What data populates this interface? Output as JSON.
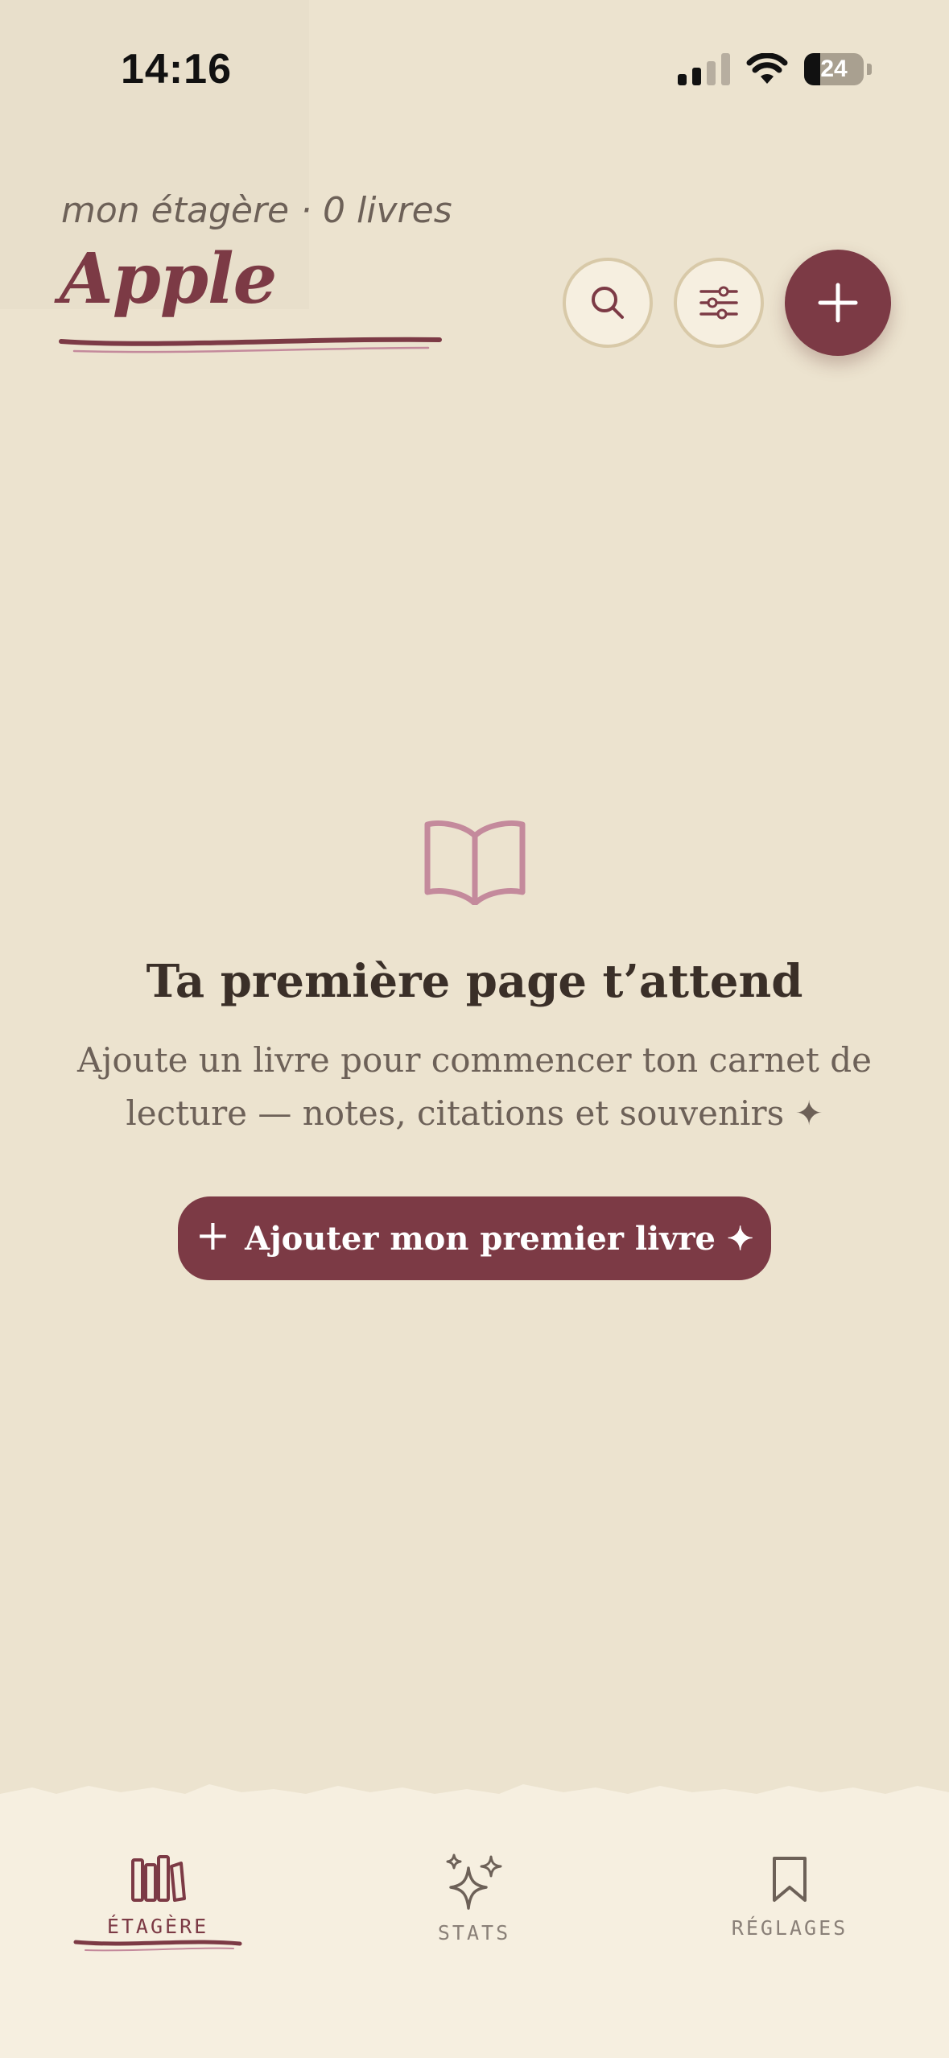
{
  "status_bar": {
    "time": "14:16",
    "battery": "24"
  },
  "header": {
    "subtitle": "mon étagère · 0 livres",
    "title": "Apple"
  },
  "actions": {
    "search_icon": "search-icon",
    "filter_icon": "sliders-icon",
    "add_icon": "plus-icon"
  },
  "empty_state": {
    "icon": "open-book-icon",
    "title": "Ta première page t’attend",
    "line1": "Ajoute un livre pour commencer ton carnet de",
    "line2": "lecture — notes, citations et souvenirs ✦",
    "cta_plus": "+",
    "cta_label": "Ajouter mon premier livre ✦"
  },
  "tabs": [
    {
      "label": "ÉTAGÈRE",
      "icon": "bookshelf-icon",
      "active": true
    },
    {
      "label": "STATS",
      "icon": "sparkles-icon",
      "active": false
    },
    {
      "label": "RÉGLAGES",
      "icon": "bookmark-icon",
      "active": false
    }
  ],
  "colors": {
    "background": "#ece3cf",
    "accent": "#7c3a45",
    "book_icon": "#c48a9c",
    "tabbar": "#f6efe0"
  }
}
